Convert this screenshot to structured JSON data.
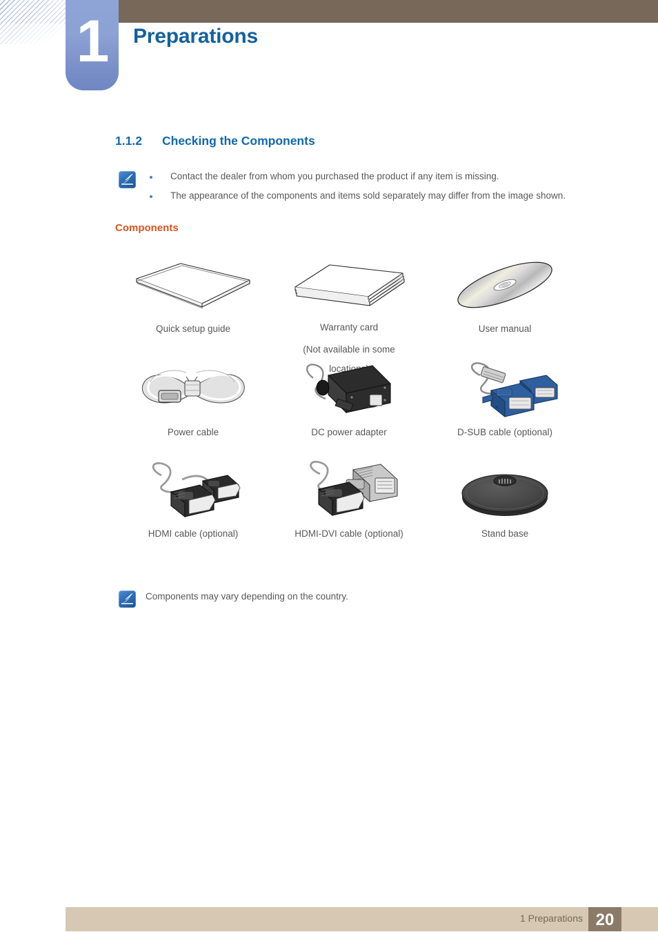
{
  "header": {
    "chapter_number": "1",
    "chapter_title": "Preparations",
    "bar_color": "#77685a",
    "badge_color": "#8299d0",
    "title_color": "#14619e"
  },
  "section": {
    "number": "1.1.2",
    "title": "Checking the Components",
    "color": "#1268ad"
  },
  "note_top": {
    "icon": "note-pen-icon",
    "bullets": [
      "Contact the dealer from whom you purchased the product if any item is missing.",
      "The appearance of the components and items sold separately may differ from the image shown."
    ]
  },
  "components_subheading": {
    "label": "Components",
    "color": "#d9541e"
  },
  "components": {
    "rows": [
      [
        {
          "icon": "booklet-icon",
          "label": "Quick setup guide",
          "sublabel": ""
        },
        {
          "icon": "stacked-cards-icon",
          "label": "Warranty card",
          "sublabel": "(Not available in some locations)"
        },
        {
          "icon": "cd-disc-icon",
          "label": "User manual",
          "sublabel": ""
        }
      ],
      [
        {
          "icon": "power-cable-icon",
          "label": "Power cable",
          "sublabel": ""
        },
        {
          "icon": "dc-adapter-icon",
          "label": "DC power adapter",
          "sublabel": ""
        },
        {
          "icon": "dsub-cable-icon",
          "label": "D-SUB cable (optional)",
          "sublabel": ""
        }
      ],
      [
        {
          "icon": "hdmi-cable-icon",
          "label": "HDMI cable (optional)",
          "sublabel": ""
        },
        {
          "icon": "hdmi-dvi-cable-icon",
          "label": "HDMI-DVI cable (optional)",
          "sublabel": ""
        },
        {
          "icon": "stand-base-icon",
          "label": "Stand base",
          "sublabel": ""
        }
      ]
    ]
  },
  "note_bottom": {
    "icon": "note-pen-icon",
    "text": "Components may vary depending on the country."
  },
  "footer": {
    "section_label": "1 Preparations",
    "page_number": "20",
    "bar_color": "#d6c8b2",
    "page_box_color": "#8b7a68"
  }
}
